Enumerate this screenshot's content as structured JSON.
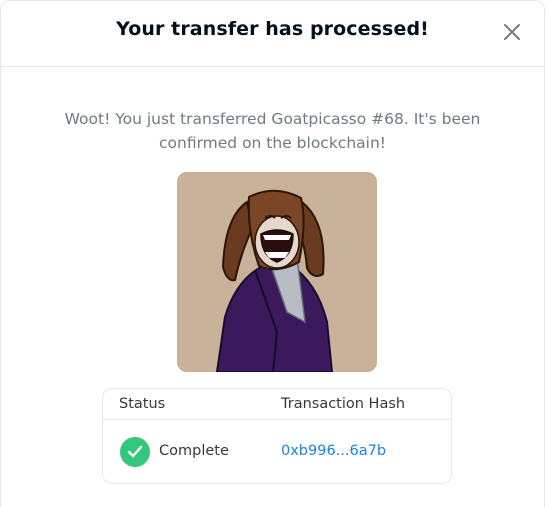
{
  "modal": {
    "title": "Your transfer has processed!",
    "message": "Woot! You just transferred Goatpicasso #68. It's been confirmed on the blockchain!",
    "close_icon": "close-icon"
  },
  "nft": {
    "name": "Goatpicasso #68",
    "background_color": "#c8b29a"
  },
  "table": {
    "columns": [
      "Status",
      "Transaction Hash"
    ],
    "row": {
      "status": "Complete",
      "status_icon": "check-circle-icon",
      "status_color": "#34c77b",
      "hash": "0xb996...6a7b"
    }
  },
  "colors": {
    "title": "#04111d",
    "text_muted": "#707a83",
    "link": "#2081e2",
    "border": "#e5e8eb"
  }
}
